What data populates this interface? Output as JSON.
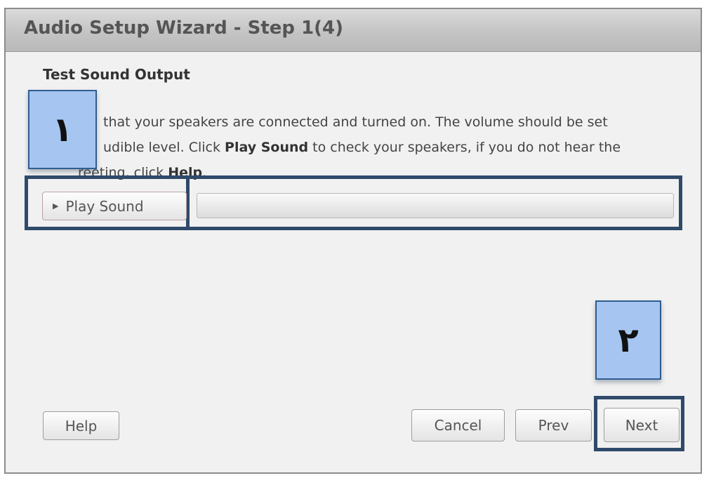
{
  "window": {
    "title": "Audio Setup Wizard - Step 1(4)"
  },
  "section": {
    "heading": "Test Sound Output",
    "description": {
      "line1": "that your speakers are connected and turned on. The volume should be set",
      "line2_a": "udible level. Click ",
      "line2_bold": "Play Sound",
      "line2_b": " to check your speakers, if you do not hear the",
      "line3_a": "reeting, click ",
      "line3_bold": "Help",
      "line3_b": "."
    }
  },
  "play_sound": {
    "label": "Play Sound",
    "icon": "play-icon",
    "progress": 0
  },
  "markers": {
    "one": "١",
    "two": "٢"
  },
  "buttons": {
    "help": "Help",
    "cancel": "Cancel",
    "prev": "Prev",
    "next": "Next"
  },
  "colors": {
    "highlight_border": "#2f4a6a",
    "marker_fill": "#a6c5f1"
  }
}
